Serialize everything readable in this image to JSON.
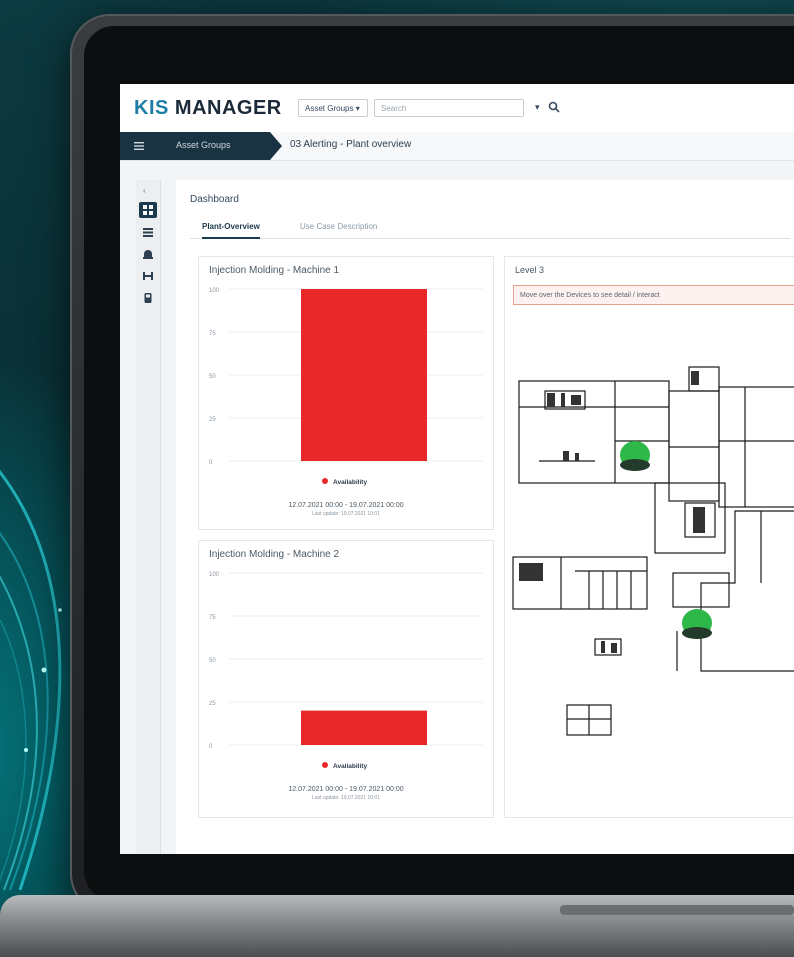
{
  "app": {
    "logo_prefix": "KIS",
    "logo_main": "MANAGER"
  },
  "topbar": {
    "asset_dropdown": "Asset Groups ▾",
    "search_placeholder": "Search",
    "caret": "▾"
  },
  "breadcrumb": {
    "asset_groups": "Asset Groups",
    "page_title": "03 Alerting - Plant overview"
  },
  "dashboard": {
    "title": "Dashboard",
    "tabs": [
      {
        "label": "Plant-Overview",
        "active": true
      },
      {
        "label": "Use Case Description",
        "active": false
      }
    ]
  },
  "charts": [
    {
      "title": "Injection Molding - Machine 1",
      "legend": "Availability",
      "date_range": "12.07.2021 00:00 - 19.07.2021 00:00",
      "last_update": "Last update: 19.07.2021 10:01"
    },
    {
      "title": "Injection Molding - Machine 2",
      "legend": "Availability",
      "date_range": "12.07.2021 00:00 - 19.07.2021 00:00",
      "last_update": "Last update: 19.07.2021 10:01"
    }
  ],
  "chart_data": [
    {
      "type": "bar",
      "title": "Injection Molding - Machine 1",
      "categories": [
        ""
      ],
      "series": [
        {
          "name": "Availability",
          "values": [
            100
          ],
          "color": "#e8292a"
        }
      ],
      "ylim": [
        0,
        100
      ],
      "yticks": [
        "100",
        "75",
        "50",
        "25",
        "0"
      ]
    },
    {
      "type": "bar",
      "title": "Injection Molding - Machine 2",
      "categories": [
        ""
      ],
      "series": [
        {
          "name": "Availability",
          "values": [
            20
          ],
          "color": "#e8292a"
        }
      ],
      "ylim": [
        0,
        100
      ],
      "yticks": [
        "100",
        "75",
        "50",
        "25",
        "0"
      ]
    }
  ],
  "level": {
    "title": "Level 3",
    "hint": "Move over the Devices to see detail / interact"
  },
  "colors": {
    "brand": "#1e7ea6",
    "navy": "#193343",
    "bar": "#e8292a",
    "ok_status": "#2fb84a"
  }
}
